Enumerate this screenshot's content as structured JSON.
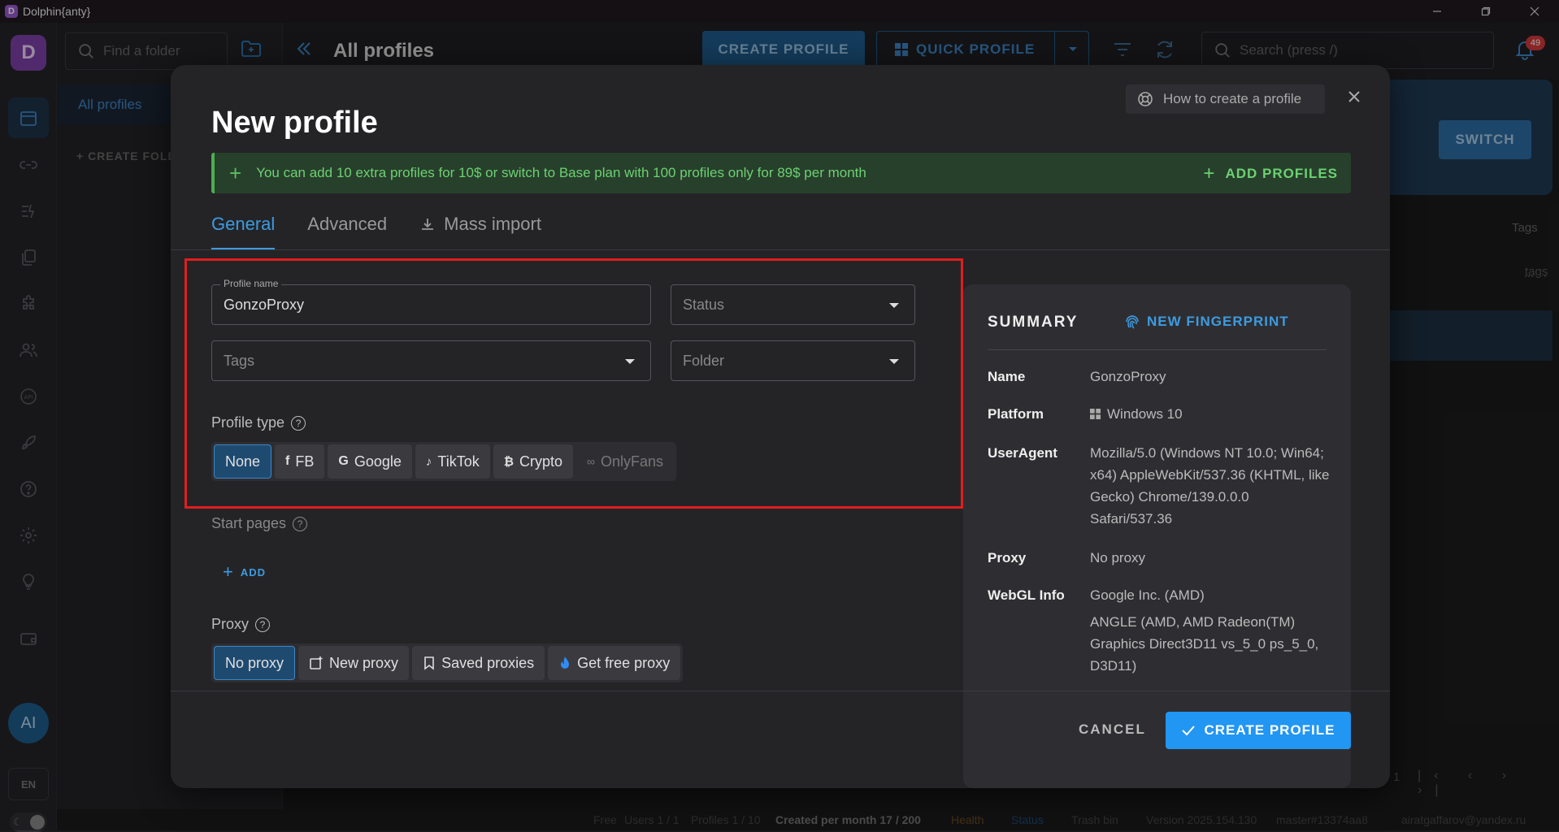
{
  "window": {
    "title": "Dolphin{anty}"
  },
  "folders": {
    "search_placeholder": "Find a folder",
    "all_profiles": "All profiles",
    "create_folder": "+ CREATE FOLDER"
  },
  "topbar": {
    "title": "All profiles",
    "create_profile": "CREATE PROFILE",
    "quick_profile": "QUICK PROFILE",
    "search_placeholder": "Search (press /)",
    "notifications": "49"
  },
  "background": {
    "switch": "SWITCH",
    "tags_header": "Tags",
    "tags_row": "tags",
    "page_number": "1"
  },
  "sidebar": {
    "avatar": "AI",
    "language": "EN"
  },
  "statusbar": {
    "plan": "Free",
    "users": "Users 1 / 1",
    "profiles": "Profiles 1 / 10",
    "created": "Created per month 17 / 200",
    "health": "Health",
    "status": "Status",
    "trash": "Trash bin",
    "version": "Version 2025.154.130",
    "branch": "master#13374aa8",
    "email": "airatgaffarov@yandex.ru"
  },
  "modal": {
    "title": "New profile",
    "how_to": "How to create a profile",
    "notice": "You can add 10 extra profiles for 10$ or switch to Base plan with 100 profiles only for 89$ per month",
    "add_profiles": "ADD PROFILES",
    "tabs": [
      {
        "label": "General"
      },
      {
        "label": "Advanced"
      },
      {
        "label": "Mass import"
      }
    ],
    "profile_name": {
      "legend": "Profile name",
      "value": "GonzoProxy"
    },
    "status_placeholder": "Status",
    "tags_placeholder": "Tags",
    "folder_placeholder": "Folder",
    "profile_type": {
      "label": "Profile type",
      "options": [
        "None",
        "FB",
        "Google",
        "TikTok",
        "Crypto",
        "OnlyFans"
      ],
      "selected": "None"
    },
    "start_pages": {
      "label": "Start pages",
      "add": "ADD"
    },
    "proxy": {
      "label": "Proxy",
      "options": [
        "No proxy",
        "New proxy",
        "Saved proxies",
        "Get free proxy"
      ],
      "selected": "No proxy"
    },
    "summary": {
      "title": "SUMMARY",
      "new_fingerprint": "NEW FINGERPRINT",
      "rows": [
        {
          "key": "Name",
          "value": "GonzoProxy"
        },
        {
          "key": "Platform",
          "value": "Windows 10"
        },
        {
          "key": "UserAgent",
          "value": "Mozilla/5.0 (Windows NT 10.0; Win64; x64) AppleWebKit/537.36 (KHTML, like Gecko) Chrome/139.0.0.0 Safari/537.36"
        },
        {
          "key": "Proxy",
          "value": "No proxy"
        },
        {
          "key": "WebGL Info",
          "value": "Google Inc. (AMD)"
        }
      ],
      "webgl_renderer": "ANGLE (AMD, AMD Radeon(TM) Graphics Direct3D11 vs_5_0 ps_5_0, D3D11)"
    },
    "cancel": "CANCEL",
    "create": "CREATE PROFILE"
  },
  "colors": {
    "accent": "#2196f3",
    "notice_green": "#6cd172",
    "highlight_red": "#e01e1e",
    "modal_bg": "#242427"
  }
}
